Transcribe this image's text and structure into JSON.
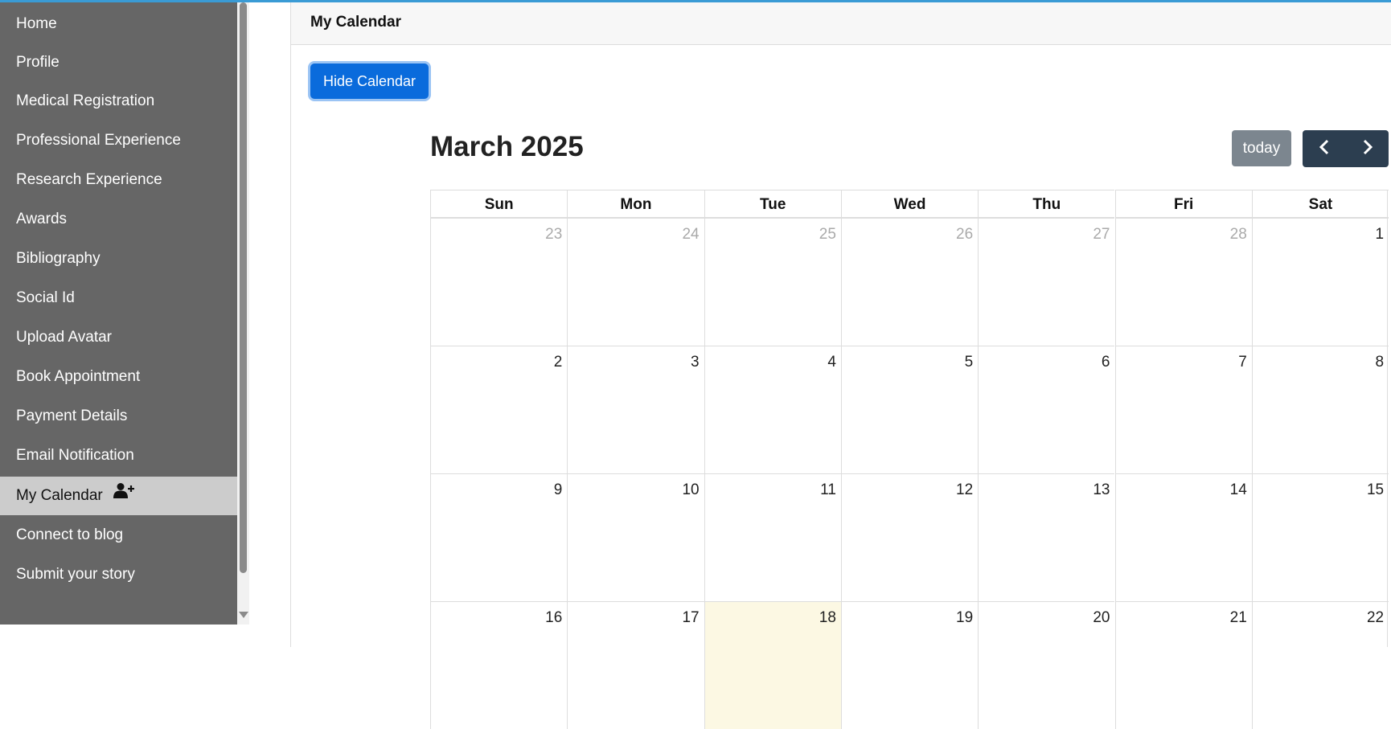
{
  "sidebar": {
    "items": [
      {
        "label": "Home"
      },
      {
        "label": "Profile"
      },
      {
        "label": "Medical Registration"
      },
      {
        "label": "Professional Experience"
      },
      {
        "label": "Research Experience"
      },
      {
        "label": "Awards"
      },
      {
        "label": "Bibliography"
      },
      {
        "label": "Social Id"
      },
      {
        "label": "Upload Avatar"
      },
      {
        "label": "Book Appointment"
      },
      {
        "label": "Payment Details"
      },
      {
        "label": "Email Notification"
      },
      {
        "label": "My Calendar",
        "active": true,
        "icon": "user-plus-icon"
      },
      {
        "label": "Connect to blog"
      },
      {
        "label": "Submit your story"
      }
    ]
  },
  "header": {
    "title": "My Calendar"
  },
  "actions": {
    "hide_calendar_label": "Hide Calendar"
  },
  "calendar": {
    "title": "March 2025",
    "today_label": "today",
    "weekdays": [
      "Sun",
      "Mon",
      "Tue",
      "Wed",
      "Thu",
      "Fri",
      "Sat"
    ],
    "weeks": [
      [
        {
          "d": "23",
          "other": true
        },
        {
          "d": "24",
          "other": true
        },
        {
          "d": "25",
          "other": true
        },
        {
          "d": "26",
          "other": true
        },
        {
          "d": "27",
          "other": true
        },
        {
          "d": "28",
          "other": true
        },
        {
          "d": "1"
        }
      ],
      [
        {
          "d": "2"
        },
        {
          "d": "3"
        },
        {
          "d": "4"
        },
        {
          "d": "5"
        },
        {
          "d": "6"
        },
        {
          "d": "7"
        },
        {
          "d": "8"
        }
      ],
      [
        {
          "d": "9"
        },
        {
          "d": "10"
        },
        {
          "d": "11"
        },
        {
          "d": "12"
        },
        {
          "d": "13"
        },
        {
          "d": "14"
        },
        {
          "d": "15"
        }
      ],
      [
        {
          "d": "16"
        },
        {
          "d": "17"
        },
        {
          "d": "18",
          "today": true
        },
        {
          "d": "19"
        },
        {
          "d": "20"
        },
        {
          "d": "21"
        },
        {
          "d": "22"
        }
      ]
    ]
  },
  "colors": {
    "accent": "#0a6bdc",
    "sidebar_bg": "#666666",
    "sidebar_active": "#cccccc",
    "today_highlight": "#fcf8e3",
    "nav_buttons": "#2c3e50",
    "today_button": "#7c868f"
  }
}
